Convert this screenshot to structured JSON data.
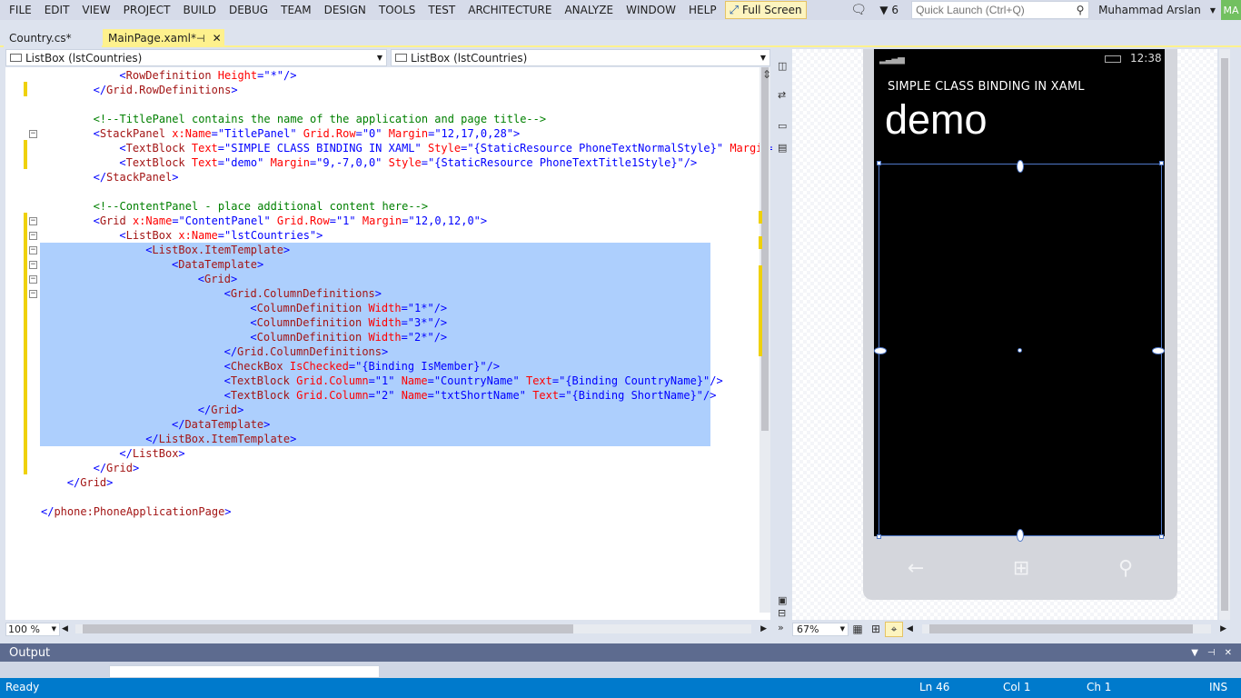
{
  "menu": [
    "FILE",
    "EDIT",
    "VIEW",
    "PROJECT",
    "BUILD",
    "DEBUG",
    "TEAM",
    "DESIGN",
    "TOOLS",
    "TEST",
    "ARCHITECTURE",
    "ANALYZE",
    "WINDOW",
    "HELP"
  ],
  "full_screen_label": "Full Screen",
  "notifications_count": "6",
  "quick_launch_placeholder": "Quick Launch (Ctrl+Q)",
  "user_name": "Muhammad Arslan",
  "user_initials": "MA",
  "tabs": [
    {
      "label": "Country.cs*"
    },
    {
      "label": "MainPage.xaml*"
    }
  ],
  "dropdowns": [
    "ListBox (lstCountries)",
    "ListBox (lstCountries)"
  ],
  "code_lines": [
    {
      "indent": 12,
      "segs": [
        [
          "punc",
          "<"
        ],
        [
          "tag",
          "RowDefinition"
        ],
        [
          "attr",
          " Height"
        ],
        [
          "punc",
          "=\"*\"/>"
        ]
      ]
    },
    {
      "indent": 8,
      "segs": [
        [
          "punc",
          "</"
        ],
        [
          "tag",
          "Grid.RowDefinitions"
        ],
        [
          "punc",
          ">"
        ]
      ]
    },
    {
      "indent": 0,
      "segs": []
    },
    {
      "indent": 8,
      "segs": [
        [
          "com",
          "<!--TitlePanel contains the name of the application and page title-->"
        ]
      ]
    },
    {
      "indent": 8,
      "segs": [
        [
          "punc",
          "<"
        ],
        [
          "tag",
          "StackPanel"
        ],
        [
          "attr",
          " x:Name"
        ],
        [
          "punc",
          "=\"TitlePanel\""
        ],
        [
          "attr",
          " Grid.Row"
        ],
        [
          "punc",
          "=\"0\""
        ],
        [
          "attr",
          " Margin"
        ],
        [
          "punc",
          "=\"12,17,0,28\">"
        ]
      ]
    },
    {
      "indent": 12,
      "segs": [
        [
          "punc",
          "<"
        ],
        [
          "tag",
          "TextBlock"
        ],
        [
          "attr",
          " Text"
        ],
        [
          "punc",
          "=\"SIMPLE CLASS BINDING IN XAML\""
        ],
        [
          "attr",
          " Style"
        ],
        [
          "punc",
          "=\"{StaticResource PhoneTextNormalStyle}\""
        ],
        [
          "attr",
          " Margin"
        ],
        [
          "punc",
          "=\""
        ]
      ]
    },
    {
      "indent": 12,
      "segs": [
        [
          "punc",
          "<"
        ],
        [
          "tag",
          "TextBlock"
        ],
        [
          "attr",
          " Text"
        ],
        [
          "punc",
          "=\"demo\""
        ],
        [
          "attr",
          " Margin"
        ],
        [
          "punc",
          "=\"9,-7,0,0\""
        ],
        [
          "attr",
          " Style"
        ],
        [
          "punc",
          "=\"{StaticResource PhoneTextTitle1Style}\"/>"
        ]
      ]
    },
    {
      "indent": 8,
      "segs": [
        [
          "punc",
          "</"
        ],
        [
          "tag",
          "StackPanel"
        ],
        [
          "punc",
          ">"
        ]
      ]
    },
    {
      "indent": 0,
      "segs": []
    },
    {
      "indent": 8,
      "segs": [
        [
          "com",
          "<!--ContentPanel - place additional content here-->"
        ]
      ]
    },
    {
      "indent": 8,
      "segs": [
        [
          "punc",
          "<"
        ],
        [
          "tag",
          "Grid"
        ],
        [
          "attr",
          " x:Name"
        ],
        [
          "punc",
          "=\"ContentPanel\""
        ],
        [
          "attr",
          " Grid.Row"
        ],
        [
          "punc",
          "=\"1\""
        ],
        [
          "attr",
          " Margin"
        ],
        [
          "punc",
          "=\"12,0,12,0\">"
        ]
      ]
    },
    {
      "indent": 12,
      "segs": [
        [
          "punc",
          "<"
        ],
        [
          "tag",
          "ListBox"
        ],
        [
          "attr",
          " x:Name"
        ],
        [
          "punc",
          "=\"lstCountries\">"
        ]
      ]
    },
    {
      "indent": 16,
      "segs": [
        [
          "punc",
          "<"
        ],
        [
          "tag",
          "ListBox.ItemTemplate"
        ],
        [
          "punc",
          ">"
        ]
      ]
    },
    {
      "indent": 20,
      "segs": [
        [
          "punc",
          "<"
        ],
        [
          "tag",
          "DataTemplate"
        ],
        [
          "punc",
          ">"
        ]
      ]
    },
    {
      "indent": 24,
      "segs": [
        [
          "punc",
          "<"
        ],
        [
          "tag",
          "Grid"
        ],
        [
          "punc",
          ">"
        ]
      ]
    },
    {
      "indent": 28,
      "segs": [
        [
          "punc",
          "<"
        ],
        [
          "tag",
          "Grid.ColumnDefinitions"
        ],
        [
          "punc",
          ">"
        ]
      ]
    },
    {
      "indent": 32,
      "segs": [
        [
          "punc",
          "<"
        ],
        [
          "tag",
          "ColumnDefinition"
        ],
        [
          "attr",
          " Width"
        ],
        [
          "punc",
          "=\"1*\"/>"
        ]
      ]
    },
    {
      "indent": 32,
      "segs": [
        [
          "punc",
          "<"
        ],
        [
          "tag",
          "ColumnDefinition"
        ],
        [
          "attr",
          " Width"
        ],
        [
          "punc",
          "=\"3*\"/>"
        ]
      ]
    },
    {
      "indent": 32,
      "segs": [
        [
          "punc",
          "<"
        ],
        [
          "tag",
          "ColumnDefinition"
        ],
        [
          "attr",
          " Width"
        ],
        [
          "punc",
          "=\"2*\"/>"
        ]
      ]
    },
    {
      "indent": 28,
      "segs": [
        [
          "punc",
          "</"
        ],
        [
          "tag",
          "Grid.ColumnDefinitions"
        ],
        [
          "punc",
          ">"
        ]
      ]
    },
    {
      "indent": 28,
      "segs": [
        [
          "punc",
          "<"
        ],
        [
          "tag",
          "CheckBox"
        ],
        [
          "attr",
          " IsChecked"
        ],
        [
          "punc",
          "=\"{Binding IsMember}\"/>"
        ]
      ]
    },
    {
      "indent": 28,
      "segs": [
        [
          "punc",
          "<"
        ],
        [
          "tag",
          "TextBlock"
        ],
        [
          "attr",
          " Grid.Column"
        ],
        [
          "punc",
          "=\"1\""
        ],
        [
          "attr",
          " Name"
        ],
        [
          "punc",
          "=\"CountryName\""
        ],
        [
          "attr",
          " Text"
        ],
        [
          "punc",
          "=\"{Binding CountryName}\"/>"
        ]
      ]
    },
    {
      "indent": 28,
      "segs": [
        [
          "punc",
          "<"
        ],
        [
          "tag",
          "TextBlock"
        ],
        [
          "attr",
          " Grid.Column"
        ],
        [
          "punc",
          "=\"2\""
        ],
        [
          "attr",
          " Name"
        ],
        [
          "punc",
          "=\"txtShortName\""
        ],
        [
          "attr",
          " Text"
        ],
        [
          "punc",
          "=\"{Binding ShortName}\"/>"
        ]
      ]
    },
    {
      "indent": 24,
      "segs": [
        [
          "punc",
          "</"
        ],
        [
          "tag",
          "Grid"
        ],
        [
          "punc",
          ">"
        ]
      ]
    },
    {
      "indent": 20,
      "segs": [
        [
          "punc",
          "</"
        ],
        [
          "tag",
          "DataTemplate"
        ],
        [
          "punc",
          ">"
        ]
      ]
    },
    {
      "indent": 16,
      "segs": [
        [
          "punc",
          "</"
        ],
        [
          "tag",
          "ListBox.ItemTemplate"
        ],
        [
          "punc",
          ">"
        ]
      ]
    },
    {
      "indent": 12,
      "segs": [
        [
          "punc",
          "</"
        ],
        [
          "tag",
          "ListBox"
        ],
        [
          "punc",
          ">"
        ]
      ]
    },
    {
      "indent": 8,
      "segs": [
        [
          "punc",
          "</"
        ],
        [
          "tag",
          "Grid"
        ],
        [
          "punc",
          ">"
        ]
      ]
    },
    {
      "indent": 4,
      "segs": [
        [
          "punc",
          "</"
        ],
        [
          "tag",
          "Grid"
        ],
        [
          "punc",
          ">"
        ]
      ]
    },
    {
      "indent": 0,
      "segs": []
    },
    {
      "indent": 0,
      "segs": [
        [
          "punc",
          "</"
        ],
        [
          "tag",
          "phone:PhoneApplicationPage"
        ],
        [
          "punc",
          ">"
        ]
      ]
    }
  ],
  "editor_zoom": "100 %",
  "designer_zoom": "67%",
  "phone": {
    "time": "12:38",
    "app_title": "SIMPLE CLASS BINDING IN XAML",
    "page_title": "demo"
  },
  "output_title": "Output",
  "status": {
    "ready": "Ready",
    "ln": "Ln 46",
    "col": "Col 1",
    "ch": "Ch 1",
    "ins": "INS"
  },
  "icons": [
    "fullscreen-icon",
    "chat-icon",
    "flag-icon",
    "search-icon",
    "pin-icon",
    "close-icon",
    "back-icon",
    "windows-icon",
    "search-icon"
  ],
  "accent_colors": {
    "tab_active": "#fef18d",
    "selection": "#adcffd",
    "statusbar": "#007acc",
    "output_header": "#5d6b8f"
  }
}
